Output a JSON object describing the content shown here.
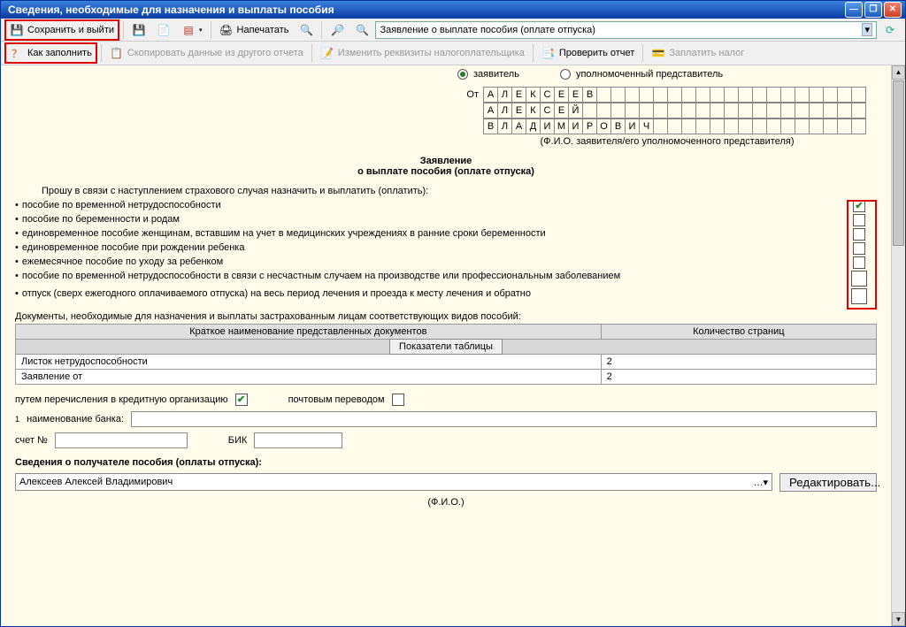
{
  "window": {
    "title": "Сведения, необходимые для назначения и выплаты пособия"
  },
  "toolbar1": {
    "save_exit": "Сохранить и выйти",
    "print": "Напечатать",
    "dropdown": "Заявление о выплате пособия (оплате отпуска)"
  },
  "toolbar2": {
    "howto": "Как заполнить",
    "copy": "Скопировать данные из другого отчета",
    "change": "Изменить реквизиты налогоплательщика",
    "check": "Проверить отчет",
    "pay": "Заплатить налог"
  },
  "radios": {
    "applicant": "заявитель",
    "representative": "уполномоченный представитель"
  },
  "name": {
    "from": "От",
    "line1": "АЛЕКСЕЕВ",
    "line2": "АЛЕКСЕЙ",
    "line3": "ВЛАДИМИРОВИЧ",
    "caption": "(Ф.И.О. заявителя/его уполномоченного представителя)"
  },
  "heading": {
    "t1": "Заявление",
    "t2": "о выплате пособия (оплате отпуска)"
  },
  "request_text": "Прошу в связи с наступлением страхового случая назначить и выплатить (оплатить):",
  "bullets": [
    "пособие по временной нетрудоспособности",
    "пособие по беременности и родам",
    "единовременное пособие женщинам, вставшим на учет в медицинских учреждениях в ранние сроки беременности",
    "единовременное пособие при рождении ребенка",
    "ежемесячное пособие по уходу за ребенком",
    "пособие по временной нетрудоспособности в связи с несчастным случаем на производстве или профессиональным заболеванием",
    "отпуск (сверх ежегодного оплачиваемого отпуска) на весь период лечения и проезда к месту лечения и обратно"
  ],
  "docs": {
    "intro": "Документы, необходимые для назначения и выплаты застрахованным лицам соответствующих видов пособий:",
    "col1": "Краткое наименование представленных документов",
    "col2": "Количество страниц",
    "btn": "Показатели таблицы",
    "r1c1": "Листок нетрудоспособности",
    "r1c2": "2",
    "r2c1": "Заявление от",
    "r2c2": "2"
  },
  "payment": {
    "credit": "путем перечисления в кредитную организацию",
    "post": "почтовым переводом",
    "bank_label": "наименование банка:",
    "account": "счет №",
    "bik": "БИК"
  },
  "recipient": {
    "heading": "Сведения о получателе пособия (оплаты отпуска):",
    "name": "Алексеев Алексей Владимирович",
    "edit": "Редактировать...",
    "fio": "(Ф.И.О.)"
  }
}
